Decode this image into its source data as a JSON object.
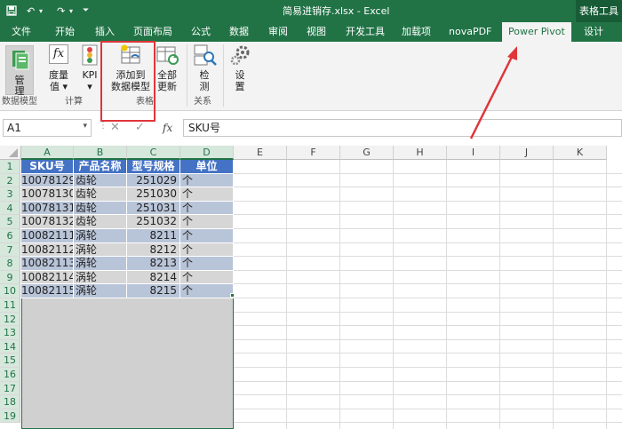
{
  "window": {
    "title": "简易进销存.xlsx - Excel",
    "context_tab_group": "表格工具"
  },
  "quick_access": {
    "save_icon": "save-icon",
    "undo_icon": "undo-icon",
    "redo_icon": "redo-icon",
    "more_icon": "dropdown-icon"
  },
  "tabs": [
    "文件",
    "开始",
    "插入",
    "页面布局",
    "公式",
    "数据",
    "审阅",
    "视图",
    "开发工具",
    "加载项",
    "novaPDF",
    "Power Pivot",
    "设计"
  ],
  "active_tab": "Power Pivot",
  "ribbon": {
    "manage": {
      "label": "管理",
      "icon": "data-model-icon"
    },
    "measures": {
      "label1": "度量",
      "label2": "值 ▾",
      "icon": "fx-icon"
    },
    "kpi": {
      "label1": "KPI",
      "label2": "▾",
      "icon": "kpi-icon"
    },
    "add_to_model": {
      "label1": "添加到",
      "label2": "数据模型",
      "icon": "add-table-icon"
    },
    "update_all": {
      "label1": "全部",
      "label2": "更新",
      "icon": "refresh-icon"
    },
    "detect": {
      "label1": "检",
      "label2": "测",
      "icon": "detect-icon"
    },
    "settings": {
      "label1": "设",
      "label2": "置",
      "icon": "gear-icon"
    },
    "groups": {
      "data_model": "数据模型",
      "calculations": "计算",
      "tables": "表格",
      "relationships": "关系"
    }
  },
  "formula_bar": {
    "name_box": "A1",
    "fx_label": "fx",
    "value": "SKU号"
  },
  "columns": [
    "A",
    "B",
    "C",
    "D",
    "E",
    "F",
    "G",
    "H",
    "I",
    "J",
    "K"
  ],
  "rows": [
    "1",
    "2",
    "3",
    "4",
    "5",
    "6",
    "7",
    "8",
    "9",
    "10",
    "11",
    "12",
    "13",
    "14",
    "15",
    "16",
    "17",
    "18",
    "19"
  ],
  "table": {
    "headers": [
      "SKU号",
      "产品名称",
      "型号规格",
      "单位"
    ],
    "rows": [
      [
        "10078129",
        "齿轮",
        "251029",
        "个"
      ],
      [
        "10078130",
        "齿轮",
        "251030",
        "个"
      ],
      [
        "10078131",
        "齿轮",
        "251031",
        "个"
      ],
      [
        "10078132",
        "齿轮",
        "251032",
        "个"
      ],
      [
        "10082111",
        "涡轮",
        "8211",
        "个"
      ],
      [
        "10082112",
        "涡轮",
        "8212",
        "个"
      ],
      [
        "10082113",
        "涡轮",
        "8213",
        "个"
      ],
      [
        "10082114",
        "涡轮",
        "8214",
        "个"
      ],
      [
        "10082115",
        "涡轮",
        "8215",
        "个"
      ]
    ]
  },
  "colors": {
    "excel_green": "#217346",
    "table_header": "#4472c4",
    "row_band_a": "#b8c4d8",
    "row_band_b": "#d6d6d6",
    "annotation_red": "#e0353a"
  }
}
